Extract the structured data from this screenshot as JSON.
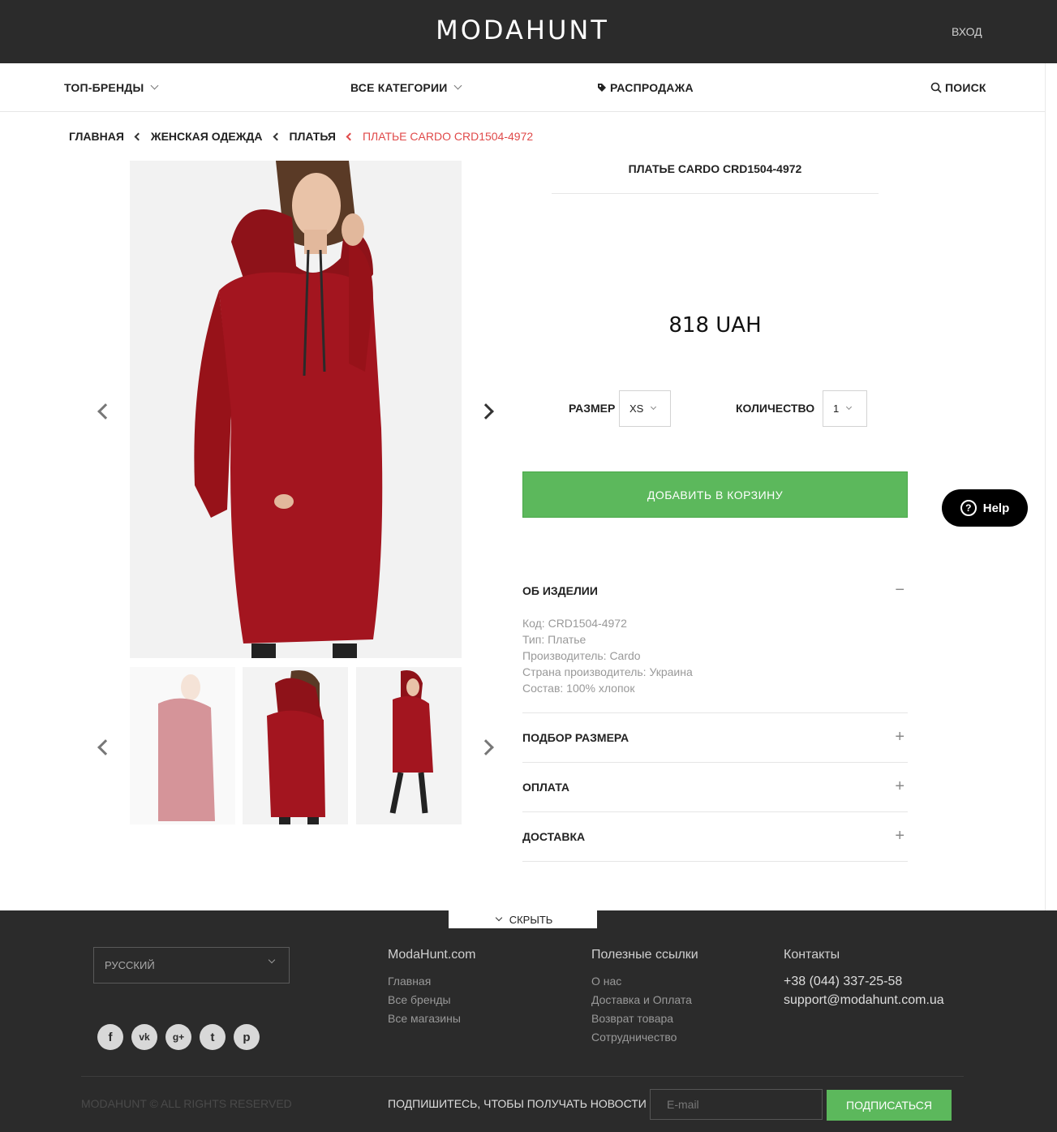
{
  "header": {
    "logo": "MODAHUNT",
    "login": "ВХОД"
  },
  "nav": {
    "top_brands": "ТОП-БРЕНДЫ",
    "all_categories": "ВСЕ КАТЕГОРИИ",
    "sale": "РАСПРОДАЖА",
    "search": "ПОИСК"
  },
  "breadcrumb": [
    "ГЛАВНАЯ",
    "ЖЕНСКАЯ ОДЕЖДА",
    "ПЛАТЬЯ",
    "ПЛАТЬЕ CARDO CRD1504-4972"
  ],
  "product": {
    "title": "ПЛАТЬЕ CARDO CRD1504-4972",
    "price": "818 UAH",
    "size_label": "РАЗМЕР",
    "size_value": "XS",
    "qty_label": "КОЛИЧЕСТВО",
    "qty_value": "1",
    "add_to_cart": "ДОБАВИТЬ В КОРЗИНУ",
    "dress_color": "#a3151f"
  },
  "help": {
    "label": "Help"
  },
  "accordion": {
    "about": {
      "title": "ОБ ИЗДЕЛИИ",
      "sign": "−"
    },
    "details": [
      "Код: CRD1504-4972",
      "Тип: Платье",
      "Производитель: Cardo",
      "Страна производитель: Украина",
      "Состав: 100% хлопок"
    ],
    "size_pick": {
      "title": "ПОДБОР РАЗМЕРА",
      "sign": "+"
    },
    "payment": {
      "title": "ОПЛАТА",
      "sign": "+"
    },
    "delivery": {
      "title": "ДОСТАВКА",
      "sign": "+"
    }
  },
  "footer": {
    "hide": "СКРЫТЬ",
    "language": "РУССКИЙ",
    "col1": {
      "title": "ModaHunt.com",
      "links": [
        "Главная",
        "Все бренды",
        "Все магазины"
      ]
    },
    "col2": {
      "title": "Полезные ссылки",
      "links": [
        "О нас",
        "Доставка и Оплата",
        "Возврат товара",
        "Сотрудничество"
      ]
    },
    "col3": {
      "title": "Контакты",
      "phone": "+38 (044) 337-25-58",
      "email": "support@modahunt.com.ua"
    },
    "copyright": "MODAHUNT © ALL RIGHTS RESERVED",
    "subscribe_label": "ПОДПИШИТЕСЬ, ЧТОБЫ ПОЛУЧАТЬ НОВОСТИ",
    "email_placeholder": "E-mail",
    "subscribe_button": "ПОДПИСАТЬСЯ",
    "social": [
      "facebook-icon",
      "vk-icon",
      "google-plus-icon",
      "twitter-icon",
      "pinterest-icon"
    ]
  },
  "colors": {
    "accent_green": "#5cb85c",
    "breadcrumb_red": "#e04a4a",
    "dark": "#2b2b2b"
  }
}
